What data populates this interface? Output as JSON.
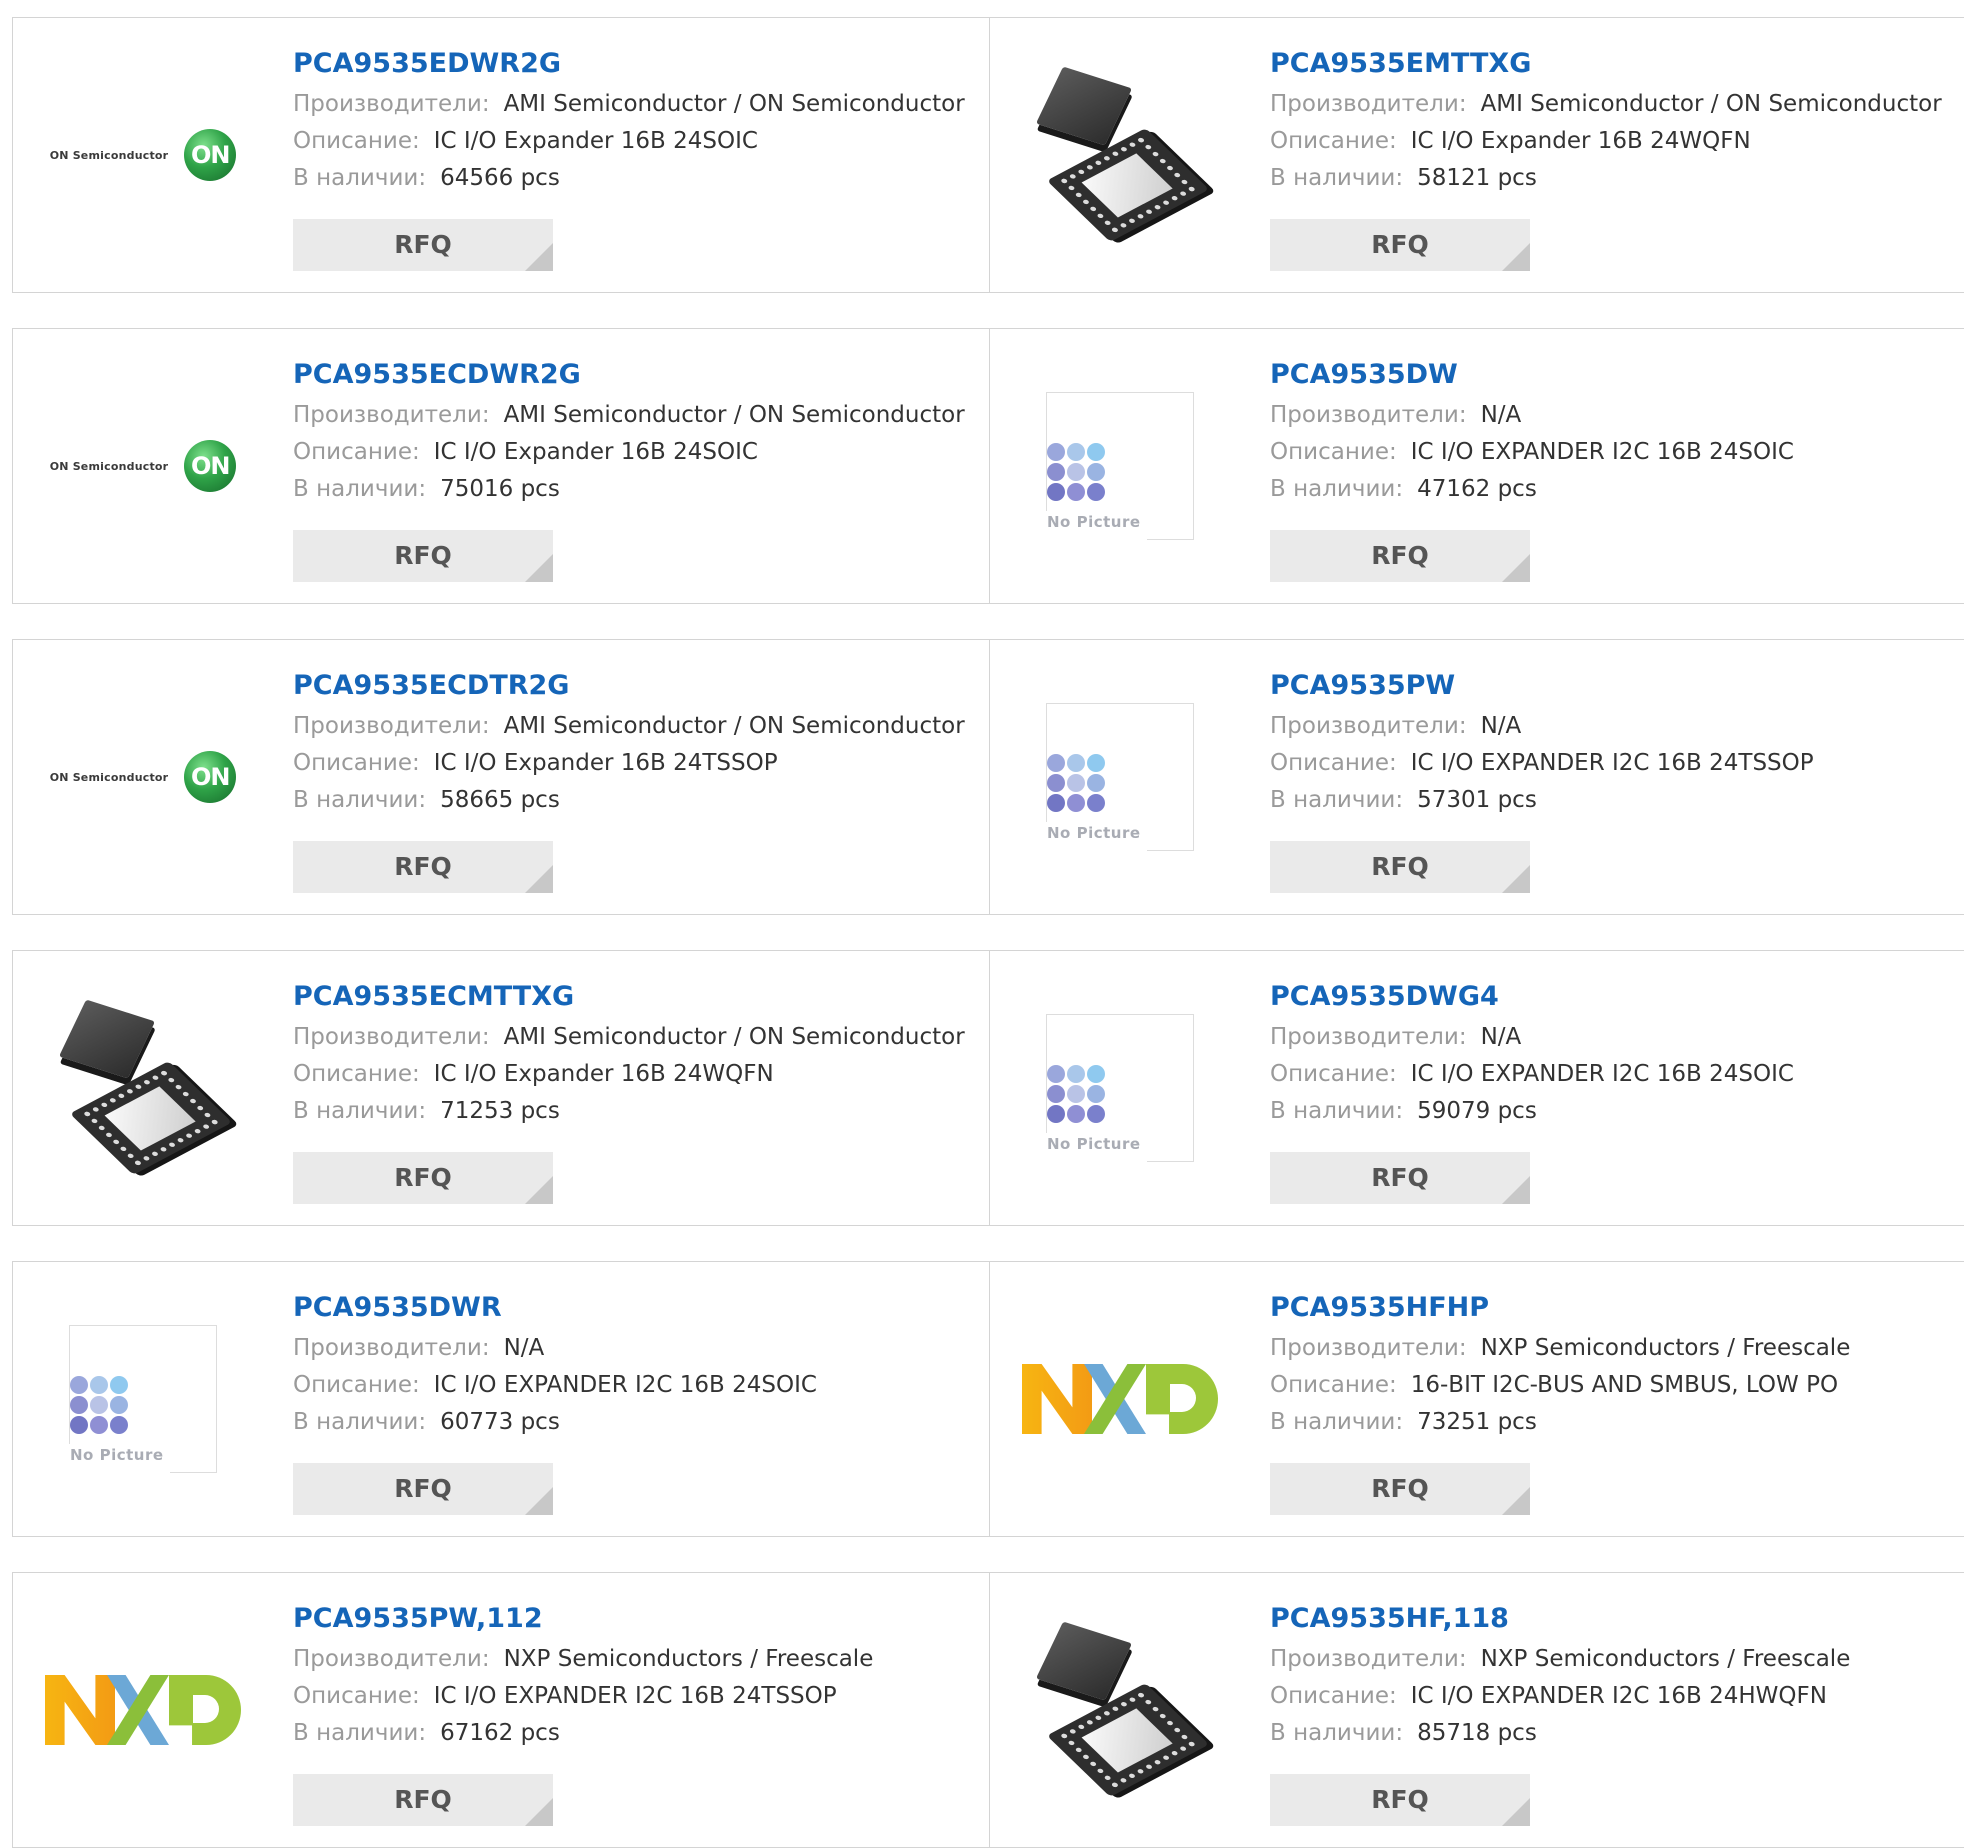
{
  "labels": {
    "manufacturer": "Производители:",
    "description": "Описание:",
    "stock": "В наличии:",
    "rfq": "RFQ",
    "no_picture": "No Picture",
    "on_semi_logo_text": "ON Semiconductor",
    "on_logo_mark": "ON"
  },
  "products": [
    {
      "part": "PCA9535EDWR2G",
      "manufacturer": "AMI Semiconductor / ON Semiconductor",
      "description": "IC I/O Expander 16B 24SOIC",
      "stock": "64566 pcs",
      "image": "on-semi-logo"
    },
    {
      "part": "PCA9535EMTTXG",
      "manufacturer": "AMI Semiconductor / ON Semiconductor",
      "description": "IC I/O Expander 16B 24WQFN",
      "stock": "58121 pcs",
      "image": "qfn-chip"
    },
    {
      "part": "PCA9535ECDWR2G",
      "manufacturer": "AMI Semiconductor / ON Semiconductor",
      "description": "IC I/O Expander 16B 24SOIC",
      "stock": "75016 pcs",
      "image": "on-semi-logo"
    },
    {
      "part": "PCA9535DW",
      "manufacturer": "N/A",
      "description": "IC I/O EXPANDER I2C 16B 24SOIC",
      "stock": "47162 pcs",
      "image": "no-picture"
    },
    {
      "part": "PCA9535ECDTR2G",
      "manufacturer": "AMI Semiconductor / ON Semiconductor",
      "description": "IC I/O Expander 16B 24TSSOP",
      "stock": "58665 pcs",
      "image": "on-semi-logo"
    },
    {
      "part": "PCA9535PW",
      "manufacturer": "N/A",
      "description": "IC I/O EXPANDER I2C 16B 24TSSOP",
      "stock": "57301 pcs",
      "image": "no-picture"
    },
    {
      "part": "PCA9535ECMTTXG",
      "manufacturer": "AMI Semiconductor / ON Semiconductor",
      "description": "IC I/O Expander 16B 24WQFN",
      "stock": "71253 pcs",
      "image": "qfn-chip"
    },
    {
      "part": "PCA9535DWG4",
      "manufacturer": "N/A",
      "description": "IC I/O EXPANDER I2C 16B 24SOIC",
      "stock": "59079 pcs",
      "image": "no-picture"
    },
    {
      "part": "PCA9535DWR",
      "manufacturer": "N/A",
      "description": "IC I/O EXPANDER I2C 16B 24SOIC",
      "stock": "60773 pcs",
      "image": "no-picture"
    },
    {
      "part": "PCA9535HFHP",
      "manufacturer": "NXP Semiconductors / Freescale",
      "description": "16-BIT I2C-BUS AND SMBUS, LOW PO",
      "stock": "73251 pcs",
      "image": "nxp-logo"
    },
    {
      "part": "PCA9535PW,112",
      "manufacturer": "NXP Semiconductors / Freescale",
      "description": "IC I/O EXPANDER I2C 16B 24TSSOP",
      "stock": "67162 pcs",
      "image": "nxp-logo"
    },
    {
      "part": "PCA9535HF,118",
      "manufacturer": "NXP Semiconductors / Freescale",
      "description": "IC I/O EXPANDER I2C 16B 24HWQFN",
      "stock": "85718 pcs",
      "image": "qfn-chip"
    }
  ],
  "colors": {
    "part_link": "#1565b8",
    "label_gray": "#9a9a9a",
    "value_text": "#333333",
    "rfq_bg": "#eaeaea",
    "border": "#d4d4d4"
  }
}
